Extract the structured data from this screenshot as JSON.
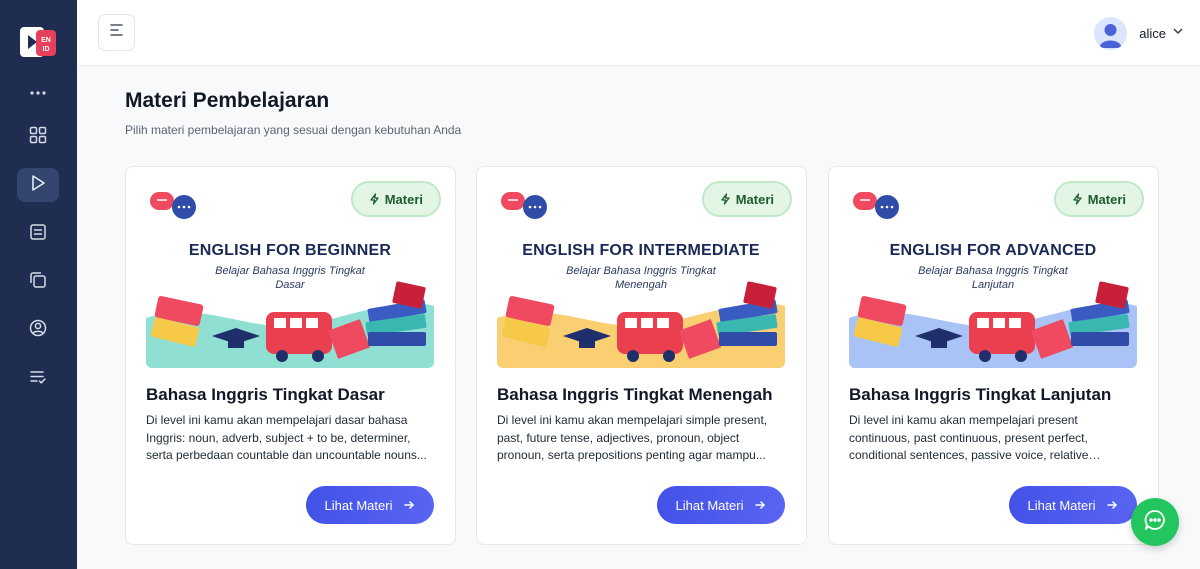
{
  "app": {
    "logo_text": "EN ID",
    "colors": {
      "sidebar": "#1e2d50",
      "accent": "#4252e8",
      "badge_bg": "#e3f6e6",
      "fab": "#22c55e"
    }
  },
  "sidebar": {
    "items": [
      {
        "icon": "more-dots-icon"
      },
      {
        "icon": "grid-icon"
      },
      {
        "icon": "play-icon",
        "active": true
      },
      {
        "icon": "document-icon"
      },
      {
        "icon": "copy-icon"
      },
      {
        "icon": "user-circle-icon"
      },
      {
        "icon": "checklist-icon"
      }
    ]
  },
  "header": {
    "menu_icon": "menu-icon",
    "username": "alice",
    "dropdown_icon": "chevron-down-icon"
  },
  "main": {
    "title": "Materi Pembelajaran",
    "subtitle": "Pilih materi pembelajaran yang sesuai dengan kebutuhan Anda"
  },
  "cards": [
    {
      "badge": "Materi",
      "thumb_title": "ENGLISH FOR BEGINNER",
      "thumb_subtitle": "Belajar Bahasa Inggris Tingkat Dasar",
      "thumb_color": "#8fe0d3",
      "title": "Bahasa Inggris Tingkat Dasar",
      "description": "Di level ini kamu akan mempelajari dasar bahasa Inggris: noun, adverb, subject + to be, determiner, serta perbedaan countable dan uncountable nouns...",
      "button": "Lihat Materi"
    },
    {
      "badge": "Materi",
      "thumb_title": "ENGLISH FOR INTERMEDIATE",
      "thumb_subtitle": "Belajar Bahasa Inggris Tingkat Menengah",
      "thumb_color": "#f9cf72",
      "title": "Bahasa Inggris Tingkat Menengah",
      "description": "Di level ini kamu akan mempelajari simple present, past, future tense, adjectives, pronoun, object pronoun, serta prepositions penting agar mampu...",
      "button": "Lihat Materi"
    },
    {
      "badge": "Materi",
      "thumb_title": "ENGLISH FOR ADVANCED",
      "thumb_subtitle": "Belajar Bahasa Inggris Tingkat Lanjutan",
      "thumb_color": "#a9c3f7",
      "title": "Bahasa Inggris Tingkat Lanjutan",
      "description": "Di level ini kamu akan mempelajari present continuous, past continuous, present perfect, conditional sentences, passive voice, relative clauses...",
      "button": "Lihat Materi"
    }
  ]
}
